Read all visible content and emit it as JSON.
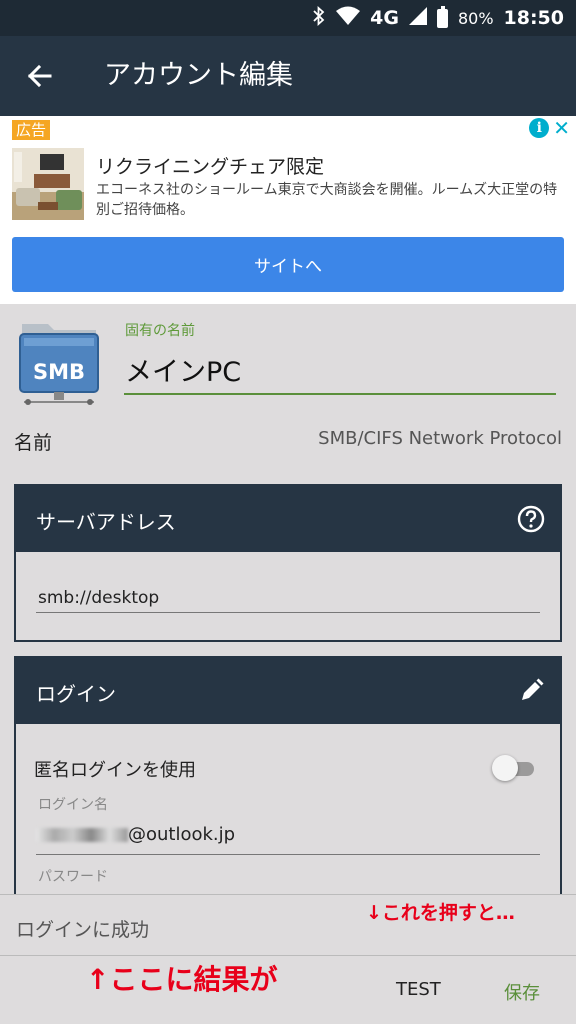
{
  "status_bar": {
    "network": "4G",
    "battery": "80%",
    "time": "18:50"
  },
  "app_bar": {
    "title": "アカウント編集"
  },
  "ad": {
    "badge": "広告",
    "headline": "リクライニングチェア限定",
    "description": "エコーネス社のショールーム東京で大商談会を開催。ルームズ大正堂の特別ご招待価格。",
    "cta": "サイトへ"
  },
  "account": {
    "icon_text": "SMB",
    "name_label": "固有の名前",
    "name_value": "メインPC",
    "protocol_label": "名前",
    "protocol_value": "SMB/CIFS Network Protocol"
  },
  "server": {
    "title": "サーバアドレス",
    "address": "smb://desktop"
  },
  "login": {
    "title": "ログイン",
    "anonymous_label": "匿名ログインを使用",
    "anonymous_enabled": false,
    "username_label": "ログイン名",
    "username_value": "@outlook.jp",
    "password_label": "パスワード"
  },
  "footer": {
    "result": "ログインに成功",
    "test_button": "TEST",
    "save_button": "保存"
  },
  "annotations": {
    "right": "↓これを押すと…",
    "left": "↑ここに結果が"
  },
  "colors": {
    "app_bar": "#263544",
    "accent_green": "#5a8f3a",
    "cta_blue": "#3c86e8",
    "annotation_red": "#e8001a"
  }
}
